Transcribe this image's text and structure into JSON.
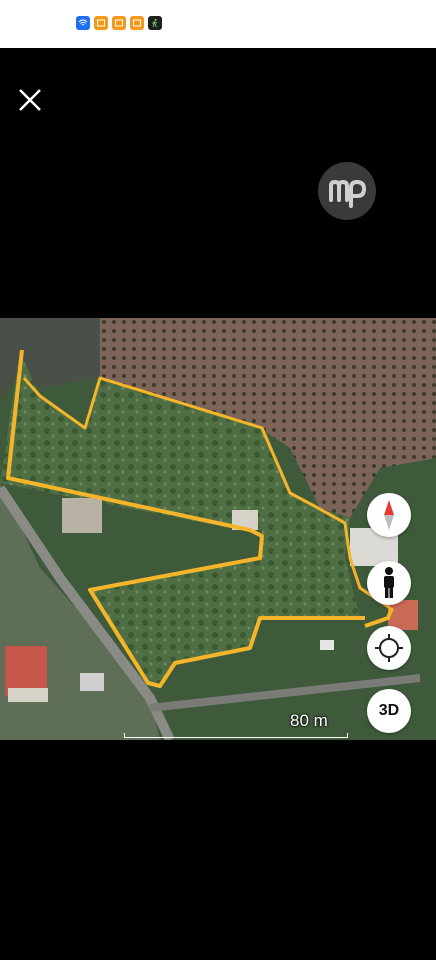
{
  "status_bar": {
    "icons": [
      "wifi-icon",
      "app-badge-icon",
      "app-badge-icon",
      "app-badge-icon",
      "walking-app-icon"
    ]
  },
  "viewer": {
    "close_icon": "close-icon",
    "watermark_text": "mp"
  },
  "map": {
    "scale_label": "80 m",
    "buttons": {
      "compass": "compass-icon",
      "street_view": "person-icon",
      "my_location": "location-target-icon",
      "mode_3d_label": "3D"
    },
    "colors": {
      "boundary": "#f5b52a",
      "button_bg": "#ffffff",
      "compass_red": "#e53935"
    }
  }
}
